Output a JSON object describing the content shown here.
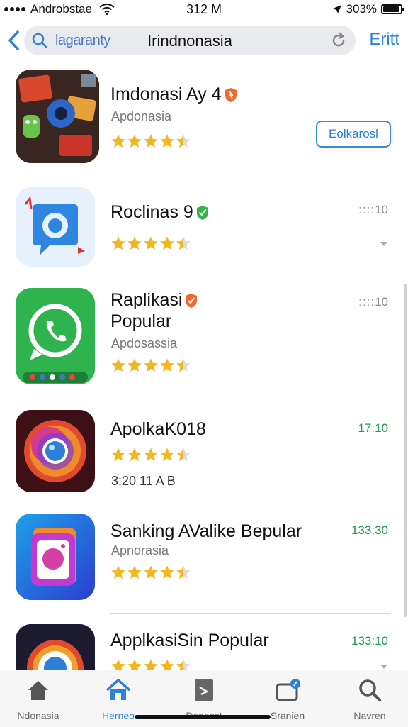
{
  "status_bar": {
    "carrier": "Androbstae",
    "time": "312 M",
    "battery": "303%"
  },
  "nav": {
    "search_placeholder": "lagaranty",
    "title": "Irindnonasia",
    "edit_label": "Eritt"
  },
  "apps": [
    {
      "name": "Imdonasi Ay 4",
      "subtitle": "Apdonasia",
      "rating": 4.5,
      "action_label": "Eolkarosl",
      "badge": "orange-shield"
    },
    {
      "name": "Roclinas 9",
      "rating": 4.5,
      "time": "10",
      "badge": "green-check"
    },
    {
      "name_line1": "Raplikasi",
      "name_line2": "Popular",
      "subtitle": "Apdosassia",
      "rating": 4.5,
      "time": "10",
      "badge": "orange-shield"
    },
    {
      "name": "ApolkaK018",
      "rating": 4.5,
      "time": "17:10",
      "meta": "3:20 11 A  B"
    },
    {
      "name": "Sanking AValike Bepular",
      "subtitle": "Apnorasia",
      "rating": 4.5,
      "time": "133:30"
    },
    {
      "name": "ApplkasiSin Popular",
      "rating": 4.5,
      "time": "133:10"
    }
  ],
  "tabs": [
    {
      "label": "Ndonasia",
      "icon": "house-icon"
    },
    {
      "label": "Herneo",
      "icon": "house-icon",
      "active": true
    },
    {
      "label": "Denesst",
      "icon": "clipboard-icon"
    },
    {
      "label": "Sranien",
      "icon": "folder-icon"
    },
    {
      "label": "Navren",
      "icon": "search-icon"
    }
  ],
  "colors": {
    "accent": "#2f80d6",
    "star": "#f5b51c",
    "time_green": "#1f9a4a"
  }
}
